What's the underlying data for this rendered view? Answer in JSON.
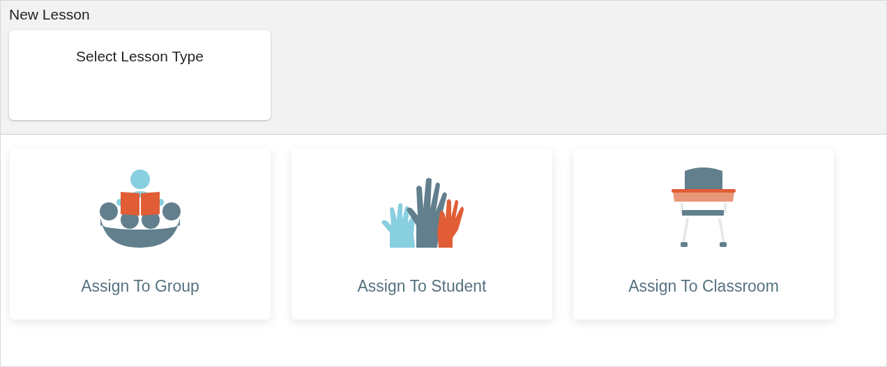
{
  "header": {
    "title": "New Lesson"
  },
  "lesson_type_card": {
    "label": "Select Lesson Type"
  },
  "options": [
    {
      "kind": "group",
      "label": "Assign To Group"
    },
    {
      "kind": "student",
      "label": "Assign To Student"
    },
    {
      "kind": "classroom",
      "label": "Assign To Classroom"
    }
  ]
}
